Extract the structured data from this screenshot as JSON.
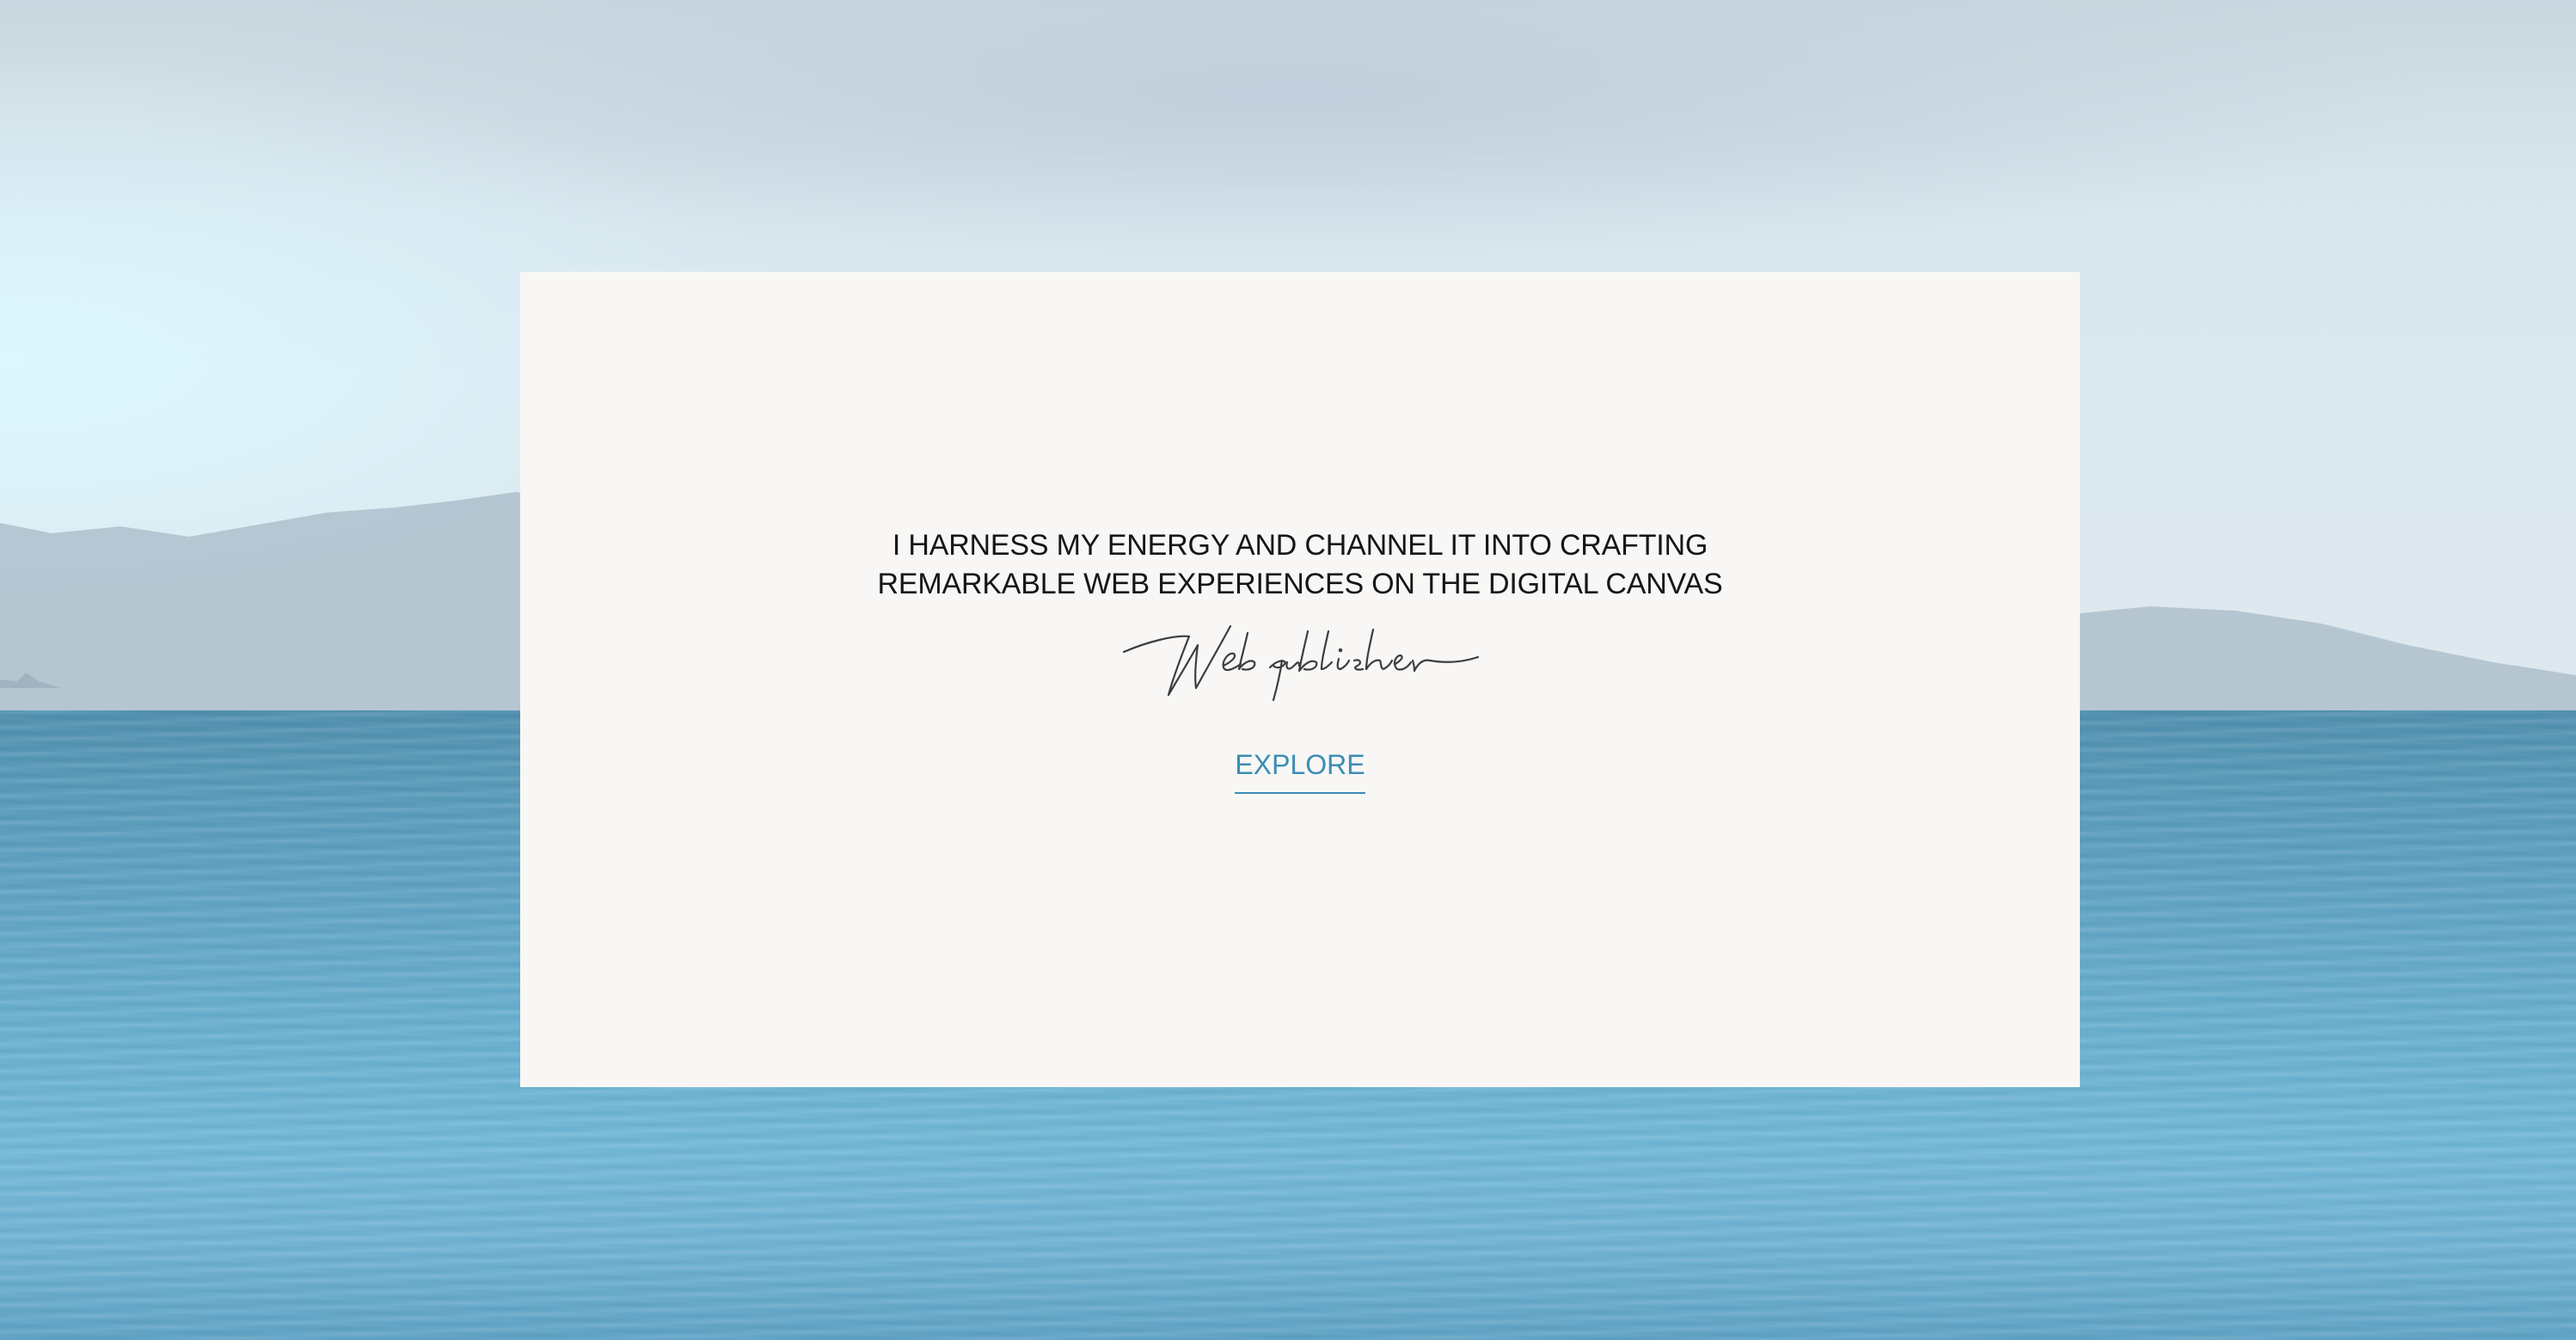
{
  "hero": {
    "tagline_line1": "I HARNESS MY ENERGY AND CHANNEL IT INTO CRAFTING",
    "tagline_line2": "REMARKABLE WEB EXPERIENCES ON THE DIGITAL CANVAS",
    "signature_text": "Web publisher",
    "cta_label": "EXPLORE"
  },
  "colors": {
    "card_background": "#f8f7f5",
    "accent": "#3c8db3",
    "text": "#161616",
    "sea": "#5fa3c2",
    "sky": "#d8e6ee"
  }
}
